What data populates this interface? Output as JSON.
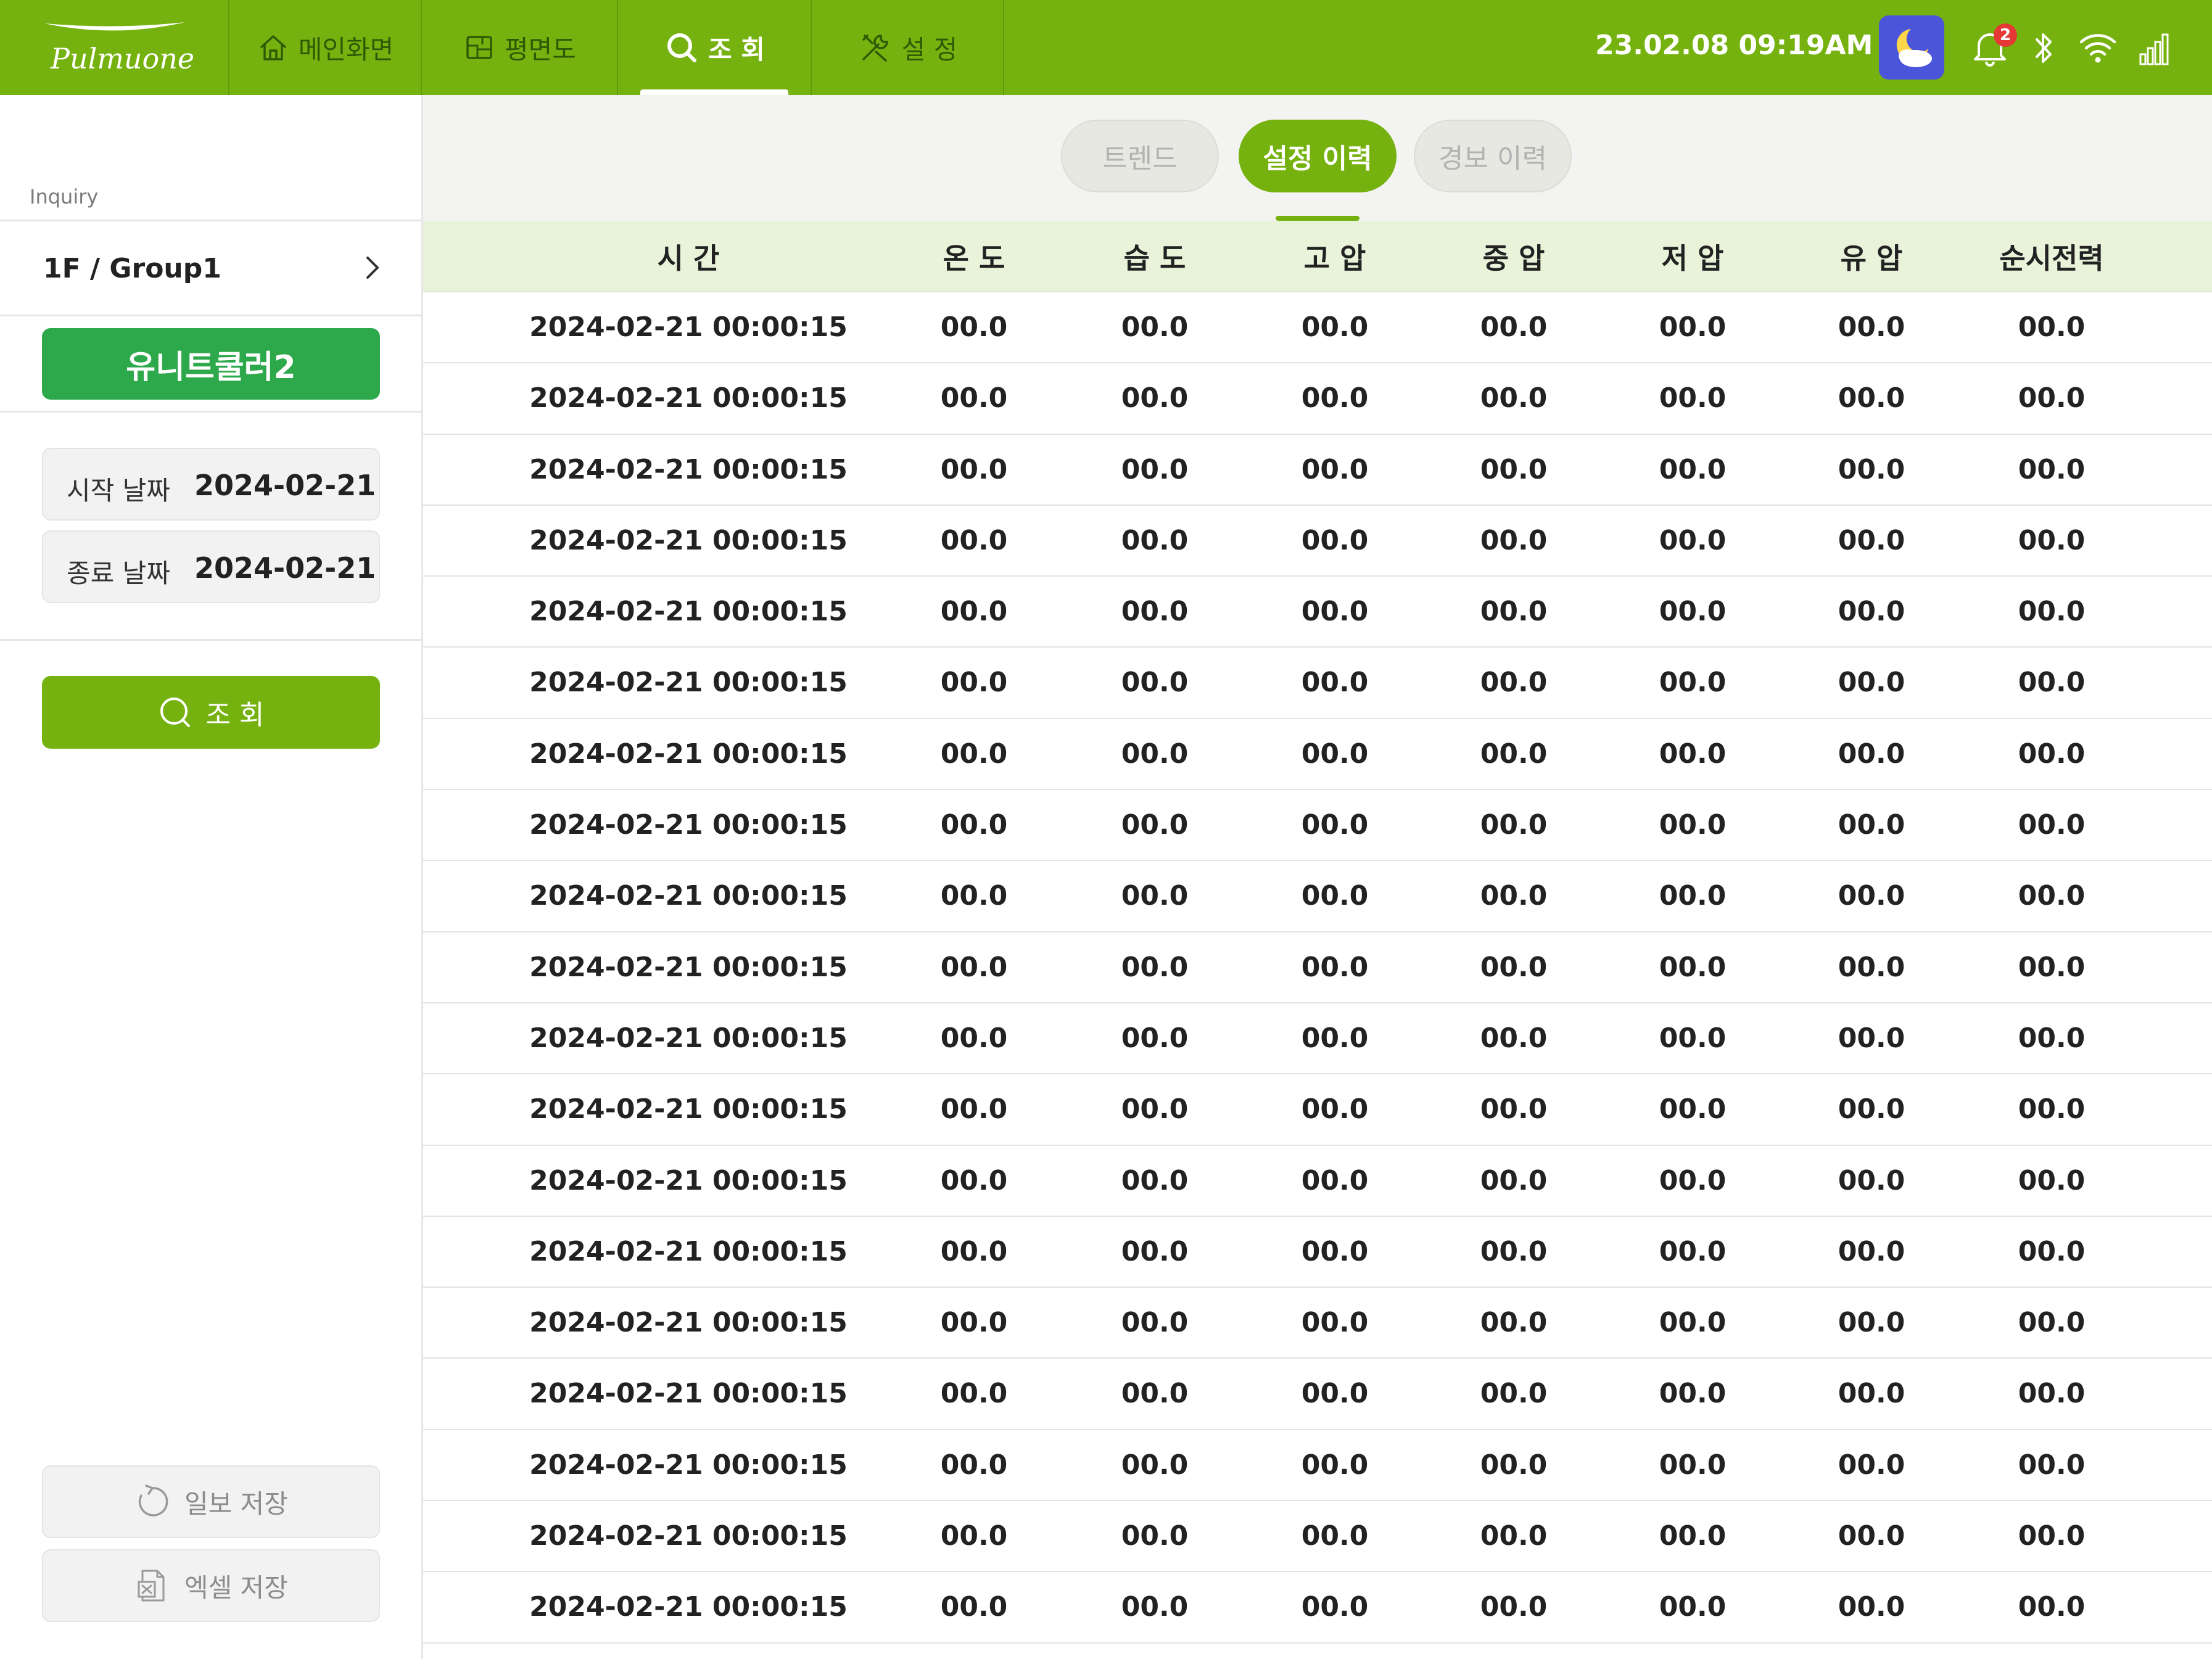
{
  "brand": {
    "logo_text": "Pulmuone"
  },
  "nav": {
    "tabs": [
      {
        "label": "메인화면",
        "icon": "home-icon",
        "active": false
      },
      {
        "label": "평면도",
        "icon": "floorplan-icon",
        "active": false
      },
      {
        "label": "조 회",
        "icon": "search-icon",
        "active": true
      },
      {
        "label": "설 정",
        "icon": "tools-icon",
        "active": false
      }
    ]
  },
  "status": {
    "datetime": "23.02.08  09:19AM",
    "weather_icon": "moon-cloud-icon",
    "notification_count": "2",
    "icons": [
      "bell-icon",
      "bluetooth-icon",
      "wifi-icon",
      "signal-icon"
    ]
  },
  "sidebar": {
    "section_label": "Inquiry",
    "group": "1F / Group1",
    "unit_button": "유니트쿨러2",
    "start_date": {
      "label": "시작 날짜",
      "value": "2024-02-21"
    },
    "end_date": {
      "label": "종료 날짜",
      "value": "2024-02-21"
    },
    "search_button": "조 회",
    "daily_save_button": "일보 저장",
    "excel_save_button": "엑셀 저장"
  },
  "tabs": [
    {
      "label": "트렌드",
      "active": false
    },
    {
      "label": "설정 이력",
      "active": true
    },
    {
      "label": "경보 이력",
      "active": false
    }
  ],
  "table": {
    "columns": [
      "시 간",
      "온 도",
      "습 도",
      "고 압",
      "중 압",
      "저 압",
      "유 압",
      "순시전력"
    ],
    "rows": [
      [
        "2024-02-21 00:00:15",
        "00.0",
        "00.0",
        "00.0",
        "00.0",
        "00.0",
        "00.0",
        "00.0"
      ],
      [
        "2024-02-21 00:00:15",
        "00.0",
        "00.0",
        "00.0",
        "00.0",
        "00.0",
        "00.0",
        "00.0"
      ],
      [
        "2024-02-21 00:00:15",
        "00.0",
        "00.0",
        "00.0",
        "00.0",
        "00.0",
        "00.0",
        "00.0"
      ],
      [
        "2024-02-21 00:00:15",
        "00.0",
        "00.0",
        "00.0",
        "00.0",
        "00.0",
        "00.0",
        "00.0"
      ],
      [
        "2024-02-21 00:00:15",
        "00.0",
        "00.0",
        "00.0",
        "00.0",
        "00.0",
        "00.0",
        "00.0"
      ],
      [
        "2024-02-21 00:00:15",
        "00.0",
        "00.0",
        "00.0",
        "00.0",
        "00.0",
        "00.0",
        "00.0"
      ],
      [
        "2024-02-21 00:00:15",
        "00.0",
        "00.0",
        "00.0",
        "00.0",
        "00.0",
        "00.0",
        "00.0"
      ],
      [
        "2024-02-21 00:00:15",
        "00.0",
        "00.0",
        "00.0",
        "00.0",
        "00.0",
        "00.0",
        "00.0"
      ],
      [
        "2024-02-21 00:00:15",
        "00.0",
        "00.0",
        "00.0",
        "00.0",
        "00.0",
        "00.0",
        "00.0"
      ],
      [
        "2024-02-21 00:00:15",
        "00.0",
        "00.0",
        "00.0",
        "00.0",
        "00.0",
        "00.0",
        "00.0"
      ],
      [
        "2024-02-21 00:00:15",
        "00.0",
        "00.0",
        "00.0",
        "00.0",
        "00.0",
        "00.0",
        "00.0"
      ],
      [
        "2024-02-21 00:00:15",
        "00.0",
        "00.0",
        "00.0",
        "00.0",
        "00.0",
        "00.0",
        "00.0"
      ],
      [
        "2024-02-21 00:00:15",
        "00.0",
        "00.0",
        "00.0",
        "00.0",
        "00.0",
        "00.0",
        "00.0"
      ],
      [
        "2024-02-21 00:00:15",
        "00.0",
        "00.0",
        "00.0",
        "00.0",
        "00.0",
        "00.0",
        "00.0"
      ],
      [
        "2024-02-21 00:00:15",
        "00.0",
        "00.0",
        "00.0",
        "00.0",
        "00.0",
        "00.0",
        "00.0"
      ],
      [
        "2024-02-21 00:00:15",
        "00.0",
        "00.0",
        "00.0",
        "00.0",
        "00.0",
        "00.0",
        "00.0"
      ],
      [
        "2024-02-21 00:00:15",
        "00.0",
        "00.0",
        "00.0",
        "00.0",
        "00.0",
        "00.0",
        "00.0"
      ],
      [
        "2024-02-21 00:00:15",
        "00.0",
        "00.0",
        "00.0",
        "00.0",
        "00.0",
        "00.0",
        "00.0"
      ],
      [
        "2024-02-21 00:00:15",
        "00.0",
        "00.0",
        "00.0",
        "00.0",
        "00.0",
        "00.0",
        "00.0"
      ]
    ]
  },
  "colors": {
    "brand_green": "#76b20f",
    "unit_green": "#2da84a",
    "header_tint": "#e9f3da",
    "weather_blue": "#4b55d9",
    "badge_red": "#e53935"
  }
}
